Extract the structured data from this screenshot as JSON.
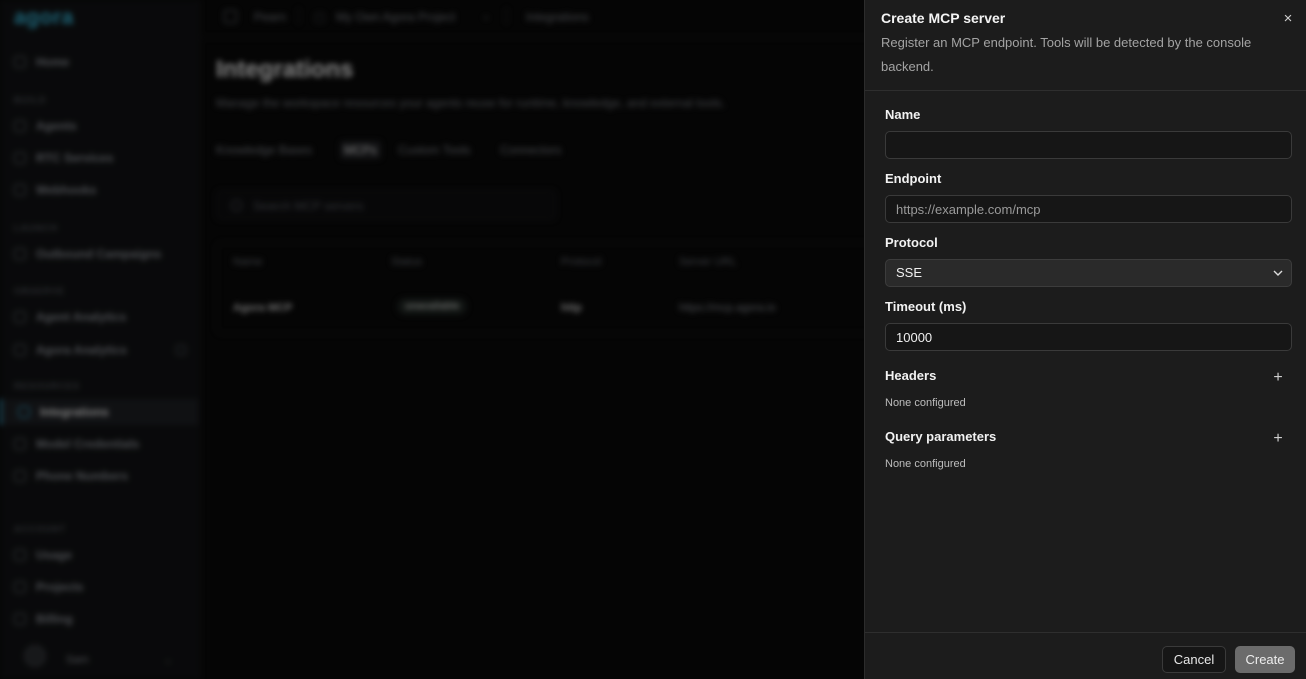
{
  "background": {
    "logo": "agora",
    "topbar": {
      "org": "Pearn",
      "project": "My Own Agora Project",
      "page": "Integrations"
    },
    "sidebar": {
      "items": [
        {
          "label": "Home"
        },
        {
          "section": "BUILD"
        },
        {
          "label": "Agents"
        },
        {
          "label": "RTC Services"
        },
        {
          "label": "Webhooks"
        },
        {
          "section": "LAUNCH"
        },
        {
          "label": "Outbound Campaigns"
        },
        {
          "section": "OBSERVE"
        },
        {
          "label": "Agent Analytics"
        },
        {
          "label": "Agora Analytics"
        },
        {
          "section": "RESOURCES"
        },
        {
          "label": "Integrations",
          "active": true
        },
        {
          "label": "Model Credentials"
        },
        {
          "label": "Phone Numbers"
        },
        {
          "section": "ACCOUNT"
        },
        {
          "label": "Usage"
        },
        {
          "label": "Projects"
        },
        {
          "label": "Billing"
        }
      ],
      "user": "Sam"
    },
    "main": {
      "title": "Integrations",
      "subtitle": "Manage the workspace resources your agents reuse for runtime, knowledge, and external tools.",
      "tabs": [
        "Knowledge Bases",
        "MCPs",
        "Custom Tools",
        "Connectors"
      ],
      "active_tab": "MCPs",
      "search_placeholder": "Search MCP servers",
      "table": {
        "headers": [
          "Name",
          "Status",
          "Protocol",
          "Server URL"
        ],
        "row": {
          "name": "Agora MCP",
          "status": "unavailable",
          "protocol": "http",
          "url": "https://mcp.agora.io"
        }
      }
    }
  },
  "sheet": {
    "title": "Create MCP server",
    "description": "Register an MCP endpoint. Tools will be detected by the console backend.",
    "close_icon": "×",
    "fields": {
      "name": {
        "label": "Name",
        "value": "",
        "placeholder": ""
      },
      "endpoint": {
        "label": "Endpoint",
        "value": "",
        "placeholder": "https://example.com/mcp"
      },
      "protocol": {
        "label": "Protocol",
        "value": "SSE"
      },
      "timeout": {
        "label": "Timeout (ms)",
        "value": "10000"
      }
    },
    "headers": {
      "title": "Headers",
      "note": "None configured",
      "add_icon": "+"
    },
    "query": {
      "title": "Query parameters",
      "note": "None configured",
      "add_icon": "+"
    },
    "footer": {
      "cancel": "Cancel",
      "create": "Create"
    }
  },
  "colors": {
    "accent": "#3ab0d6",
    "panel": "#1c1c1c",
    "create_button": "#6b6b6b"
  }
}
